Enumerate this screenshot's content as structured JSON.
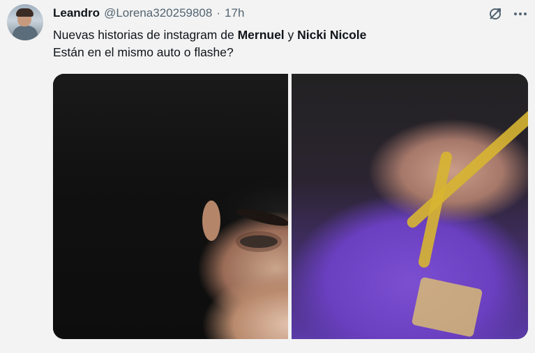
{
  "tweet": {
    "author_name": "Leandro",
    "handle": "@Lorena320259808",
    "separator": "·",
    "time": "17h",
    "text_line1": {
      "part1": "Nuevas historias de instagram de ",
      "bold1": "Mernuel",
      "part2": " y ",
      "bold2": "Nicki Nicole"
    },
    "text_line2": "Están en el mismo auto o flashe?"
  },
  "icons": {
    "grok": "grok-icon",
    "more": "more-icon"
  },
  "colors": {
    "background": "#f3f3f3",
    "text": "#0f1419",
    "secondary": "#536471"
  }
}
